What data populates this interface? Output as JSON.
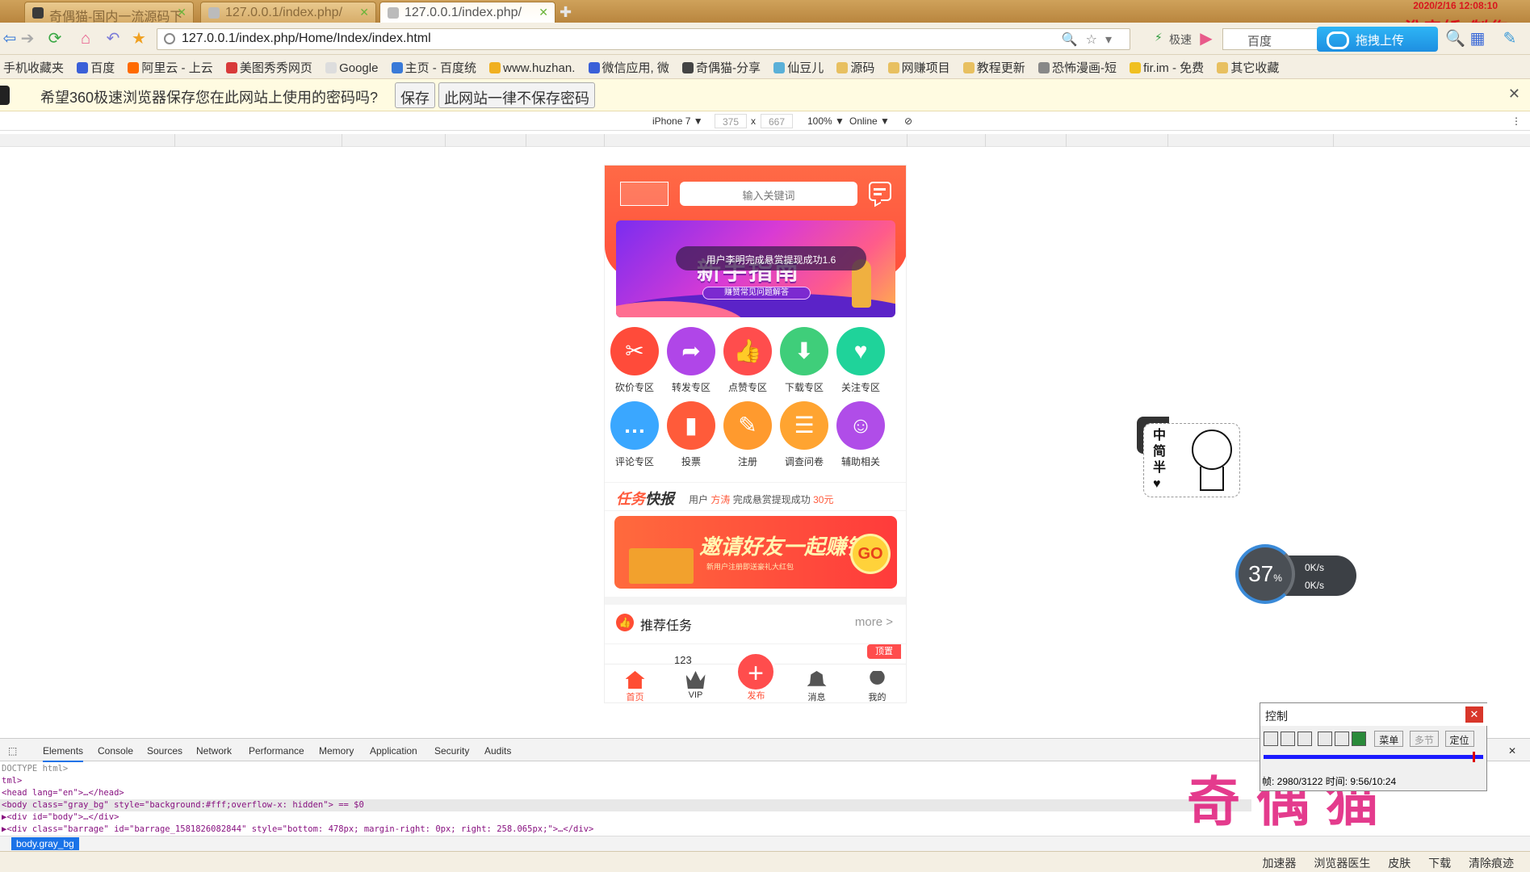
{
  "browser": {
    "tabs": [
      {
        "title": "奇偶猫-国内一流源码下"
      },
      {
        "title": "127.0.0.1/index.php/"
      },
      {
        "title": "127.0.0.1/index.php/"
      }
    ],
    "watermark_top": "淮安娇 制作",
    "date_top": "2020/2/16 12:08:10",
    "url": "127.0.0.1/index.php/Home/Index/index.html",
    "speed_label": "极速",
    "search_placeholder": "百度",
    "upload_label": "拖拽上传",
    "bookmarks": [
      "手机收藏夹",
      "百度",
      "阿里云 - 上云",
      "美图秀秀网页",
      "Google",
      "主页 - 百度统",
      "www.huzhan.",
      "微信应用, 微",
      "奇偶猫-分享",
      "仙豆儿",
      "源码",
      "网赚项目",
      "教程更新",
      "恐怖漫画-短",
      "fir.im - 免费",
      "其它收藏"
    ],
    "password_prompt": "希望360极速浏览器保存您在此网站上使用的密码吗?",
    "save_label": "保存",
    "never_label": "此网站一律不保存密码"
  },
  "device": {
    "name": "iPhone 7 ▼",
    "width": "375",
    "x": "x",
    "height": "667",
    "zoom": "100% ▼",
    "network": "Online ▼"
  },
  "app": {
    "search_placeholder": "输入关键词",
    "banner_big": "新手指南",
    "banner_sub": "赚赞常见问题解答",
    "toast": "用户李明完成悬赏提现成功1.6",
    "grid": [
      {
        "label": "砍价专区",
        "color": "#ff4b3a",
        "glyph": "✂"
      },
      {
        "label": "转发专区",
        "color": "#b046e8",
        "glyph": "➦"
      },
      {
        "label": "点赞专区",
        "color": "#ff4d4d",
        "glyph": "👍"
      },
      {
        "label": "下载专区",
        "color": "#3fce7a",
        "glyph": "⬇"
      },
      {
        "label": "关注专区",
        "color": "#1fd39a",
        "glyph": "♥"
      },
      {
        "label": "评论专区",
        "color": "#3aa7ff",
        "glyph": "…"
      },
      {
        "label": "投票",
        "color": "#ff5b3a",
        "glyph": "▮"
      },
      {
        "label": "注册",
        "color": "#ff9a2e",
        "glyph": "✎"
      },
      {
        "label": "调查问卷",
        "color": "#ffa431",
        "glyph": "☰"
      },
      {
        "label": "辅助相关",
        "color": "#b04de8",
        "glyph": "☺"
      }
    ],
    "news_tag_a": "任务",
    "news_tag_b": "快报",
    "news_prefix": "用户",
    "news_user": "方涛",
    "news_mid": "完成悬赏提现成功",
    "news_amount": "30元",
    "invite_title": "邀请好友一起赚钱",
    "invite_sub": "新用户注册即送豪礼大红包",
    "invite_go": "GO",
    "rec_title": "推荐任务",
    "rec_more": "more >",
    "card_num": "123",
    "card_badge": "顶置",
    "tabs": [
      "首页",
      "VIP",
      "发布",
      "消息",
      "我的"
    ]
  },
  "widgets": {
    "sticker_text": "中简半♥",
    "speed_pct": "37",
    "speed_unit": "%",
    "up": "0K/s",
    "down": "0K/s"
  },
  "devtools": {
    "tabs": [
      "Elements",
      "Console",
      "Sources",
      "Network",
      "Performance",
      "Memory",
      "Application",
      "Security",
      "Audits"
    ],
    "lines": [
      "DOCTYPE html>",
      "tml>",
      "<head lang=\"en\">…</head>",
      "<body class=\"gray_bg\" style=\"background:#fff;overflow-x: hidden\"> == $0",
      "▶<div id=\"body\">…</div>",
      "▶<div class=\"barrage\" id=\"barrage_1581826082844\" style=\"bottom: 478px; margin-right: 0px; right: 258.065px;\">…</div>"
    ],
    "crumb": "body.gray_bg"
  },
  "control": {
    "title": "控制",
    "menu": "菜单",
    "multi": "多节",
    "locate": "定位",
    "info": "帧: 2980/3122 时间: 9:56/10:24"
  },
  "bottom_logo": "奇偶猫",
  "status": [
    "加速器",
    "浏览器医生",
    "皮肤",
    "下载",
    "清除痕迹"
  ]
}
